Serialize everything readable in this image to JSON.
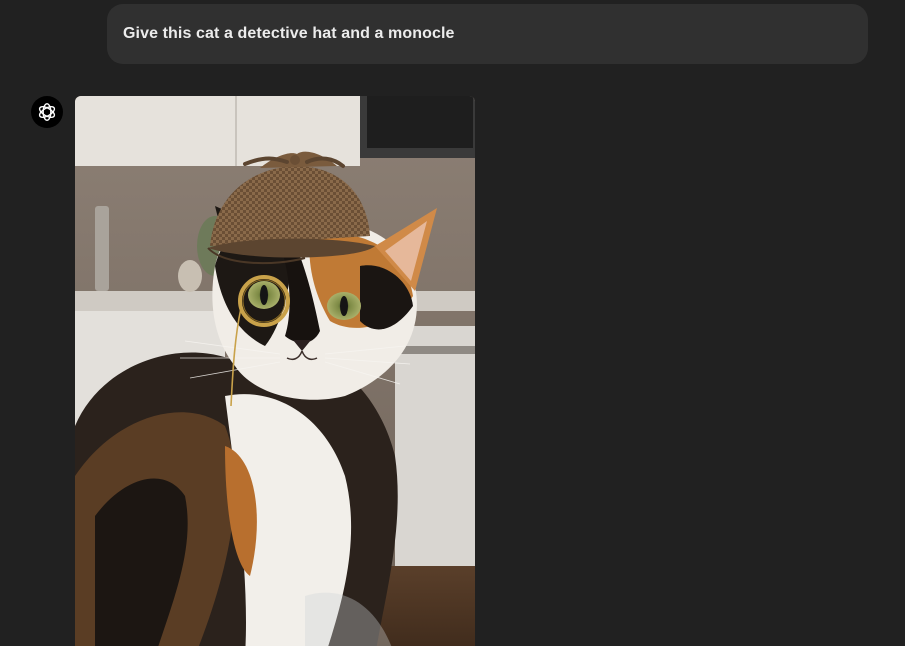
{
  "conversation": {
    "user_message": "Give this cat a detective hat and a monocle"
  },
  "assistant": {
    "avatar_icon": "openai-logo-icon",
    "image": {
      "subject": "calico-cat-detective-hat-monocle"
    }
  },
  "colors": {
    "background": "#212121",
    "user_bubble": "#303030",
    "text": "#ececec"
  }
}
